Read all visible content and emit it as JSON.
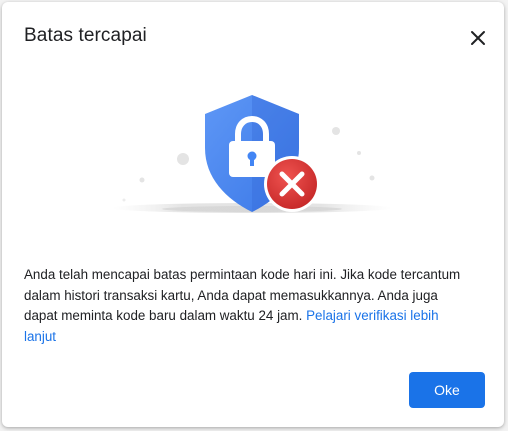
{
  "dialog": {
    "title": "Batas tercapai",
    "message": "Anda telah mencapai batas permintaan kode hari ini. Jika kode tercantum dalam histori transaksi kartu, Anda dapat memasukkannya. Anda juga dapat meminta kode baru dalam waktu 24 jam.",
    "learn_more_link": "Pelajari verifikasi lebih lanjut",
    "ok_label": "Oke",
    "illustration_icons": [
      "security-shield-icon",
      "padlock-icon",
      "error-x-icon"
    ],
    "colors": {
      "accent": "#1a73e8",
      "shield": "#4285f4",
      "error": "#d93025",
      "text": "#202124"
    }
  }
}
